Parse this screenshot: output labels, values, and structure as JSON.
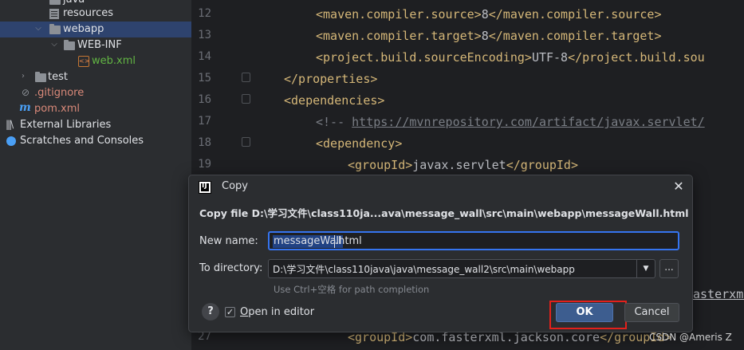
{
  "project_tree": [
    {
      "name": "java",
      "icon": "folder-icon"
    },
    {
      "name": "resources",
      "icon": "resources-folder-icon"
    },
    {
      "name": "webapp",
      "icon": "folder-icon",
      "expanded": true,
      "selected": true
    },
    {
      "name": "WEB-INF",
      "icon": "folder-icon",
      "expanded": true
    },
    {
      "name": "web.xml",
      "icon": "xml-file-icon"
    },
    {
      "name": "test",
      "icon": "folder-icon",
      "expanded": false
    },
    {
      "name": ".gitignore",
      "icon": "gitignore-file-icon"
    },
    {
      "name": "pom.xml",
      "icon": "maven-file-icon"
    },
    {
      "name": "External Libraries",
      "icon": "libraries-icon"
    },
    {
      "name": "Scratches and Consoles",
      "icon": "scratches-icon"
    }
  ],
  "editor": {
    "line_numbers": [
      "12",
      "13",
      "14",
      "15",
      "16",
      "17",
      "18",
      "19",
      "27"
    ],
    "lines": [
      {
        "parts": [
          {
            "t": "tag",
            "v": "<maven.compiler.source>"
          },
          {
            "t": "txt",
            "v": "8"
          },
          {
            "t": "tag",
            "v": "</maven.compiler.source>"
          }
        ]
      },
      {
        "parts": [
          {
            "t": "tag",
            "v": "<maven.compiler.target>"
          },
          {
            "t": "txt",
            "v": "8"
          },
          {
            "t": "tag",
            "v": "</maven.compiler.target>"
          }
        ]
      },
      {
        "parts": [
          {
            "t": "tag",
            "v": "<project.build.sourceEncoding>"
          },
          {
            "t": "txt",
            "v": "UTF-8"
          },
          {
            "t": "tag",
            "v": "</project.build.sou"
          }
        ]
      },
      {
        "parts": [
          {
            "t": "tag",
            "v": "</properties>"
          }
        ]
      },
      {
        "parts": [
          {
            "t": "tag",
            "v": "<dependencies>"
          }
        ]
      },
      {
        "parts": [
          {
            "t": "cmt",
            "v": "<!-- "
          },
          {
            "t": "lnk",
            "v": "https://mvnrepository.com/artifact/javax.servlet/"
          }
        ]
      },
      {
        "parts": [
          {
            "t": "tag",
            "v": "<dependency>"
          }
        ]
      },
      {
        "parts": [
          {
            "t": "tag",
            "v": "<groupId>"
          },
          {
            "t": "txt",
            "v": "javax.servlet"
          },
          {
            "t": "tag",
            "v": "</groupId>"
          }
        ]
      },
      {
        "parts": [
          {
            "t": "tag",
            "v": "<groupId>"
          },
          {
            "t": "txt",
            "v": "com.fasterxml.jackson.core"
          },
          {
            "t": "tag",
            "v": "</groupId>"
          }
        ]
      }
    ],
    "partial_text": "fasterxml."
  },
  "dialog": {
    "title": "Copy",
    "heading": "Copy file D:\\学习文件\\class110ja...ava\\message_wall\\src\\main\\webapp\\messageWall.html",
    "new_name_label": "New name:",
    "new_name_selected": "messageWall",
    "new_name_rest": ".html",
    "to_directory_label": "To directory:",
    "to_directory_value": "D:\\学习文件\\class110java\\java\\message_wall2\\src\\main\\webapp",
    "browse_label": "...",
    "hint": "Use Ctrl+空格 for path completion",
    "help_label": "?",
    "open_in_editor_label": "Open in editor",
    "open_in_editor_checked": true,
    "ok_label": "OK",
    "cancel_label": "Cancel"
  },
  "watermark": "CSDN @Ameris Z",
  "colors": {
    "accent": "#3574f0",
    "highlight_box": "#e3201b",
    "xml_tag": "#d5b778",
    "selection": "#2e436e"
  }
}
